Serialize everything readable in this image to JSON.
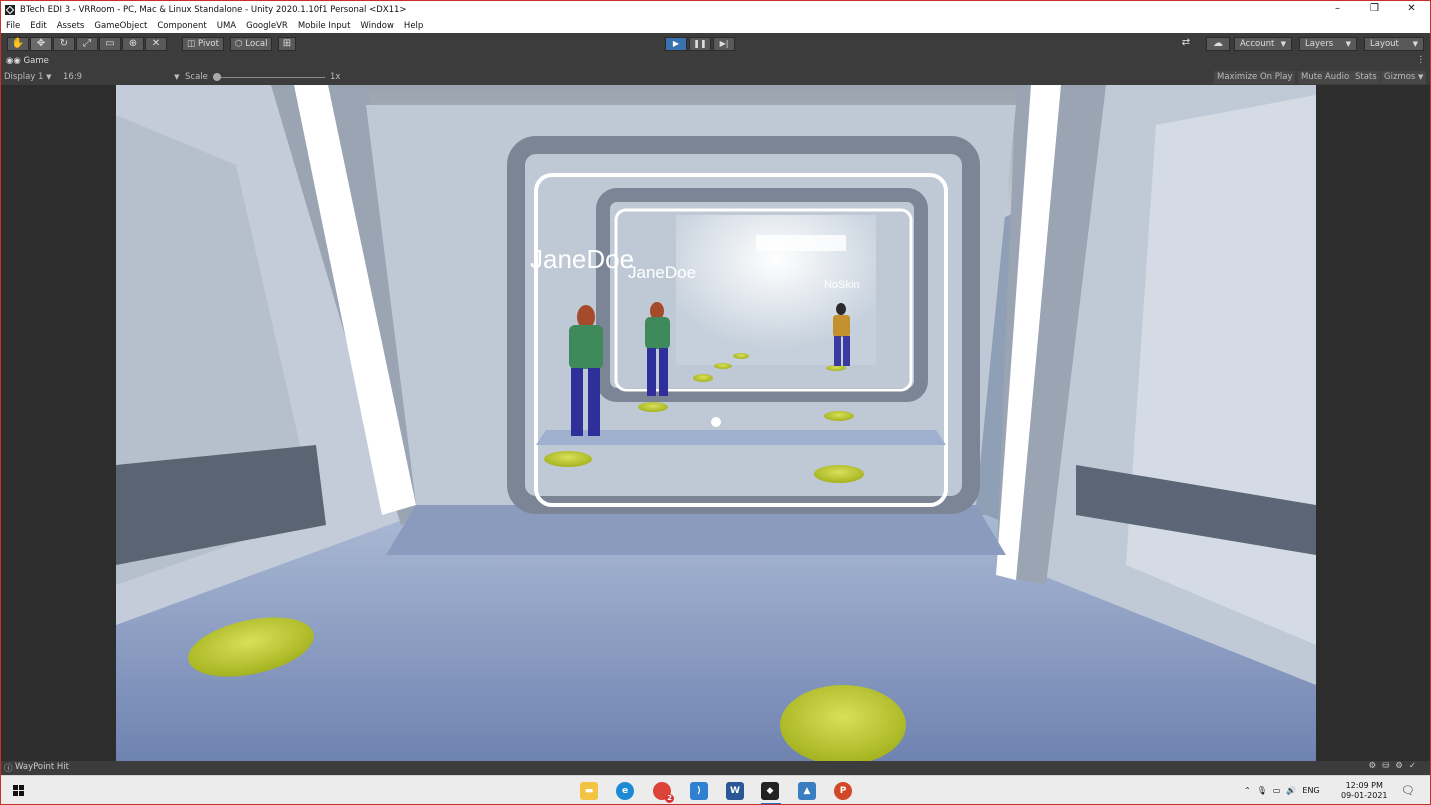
{
  "window": {
    "title": "BTech EDI 3 - VRRoom - PC, Mac & Linux Standalone - Unity 2020.1.10f1 Personal <DX11>",
    "minimize_glyph": "–",
    "maximize_glyph": "❐",
    "close_glyph": "✕"
  },
  "menu": [
    "File",
    "Edit",
    "Assets",
    "GameObject",
    "Component",
    "UMA",
    "GoogleVR",
    "Mobile Input",
    "Window",
    "Help"
  ],
  "toolbar": {
    "pivot_label": "Pivot",
    "local_label": "Local",
    "account_label": "Account",
    "layers_label": "Layers",
    "layout_label": "Layout",
    "play_state": "playing"
  },
  "game_tab": {
    "title": "Game",
    "display": "Display 1",
    "aspect": "16:9",
    "scale_label": "Scale",
    "scale_value": "1x",
    "maximize_on_play": "Maximize On Play",
    "mute_audio": "Mute Audio",
    "stats": "Stats",
    "gizmos": "Gizmos"
  },
  "scene": {
    "players": [
      {
        "name": "JaneDoe",
        "outfit": "#2f2f9a"
      },
      {
        "name": "JaneDoe",
        "outfit": "#2f2f9a"
      },
      {
        "name": "NoSkin",
        "outfit": "#3a3aa0"
      }
    ],
    "waypoint_color": "#b9c62a"
  },
  "status": {
    "message": "WayPoint Hit"
  },
  "taskbar": {
    "apps": [
      "file-explorer",
      "edge",
      "chrome",
      "vscode",
      "word",
      "unity",
      "photos",
      "powerpoint"
    ],
    "chrome_badge": "2",
    "language": "ENG",
    "time": "12:09 PM",
    "date": "09-01-2021"
  },
  "colors": {
    "accent": "#3a72b0",
    "window_border": "#c9302c",
    "editor_bg": "#3c3c3c"
  }
}
